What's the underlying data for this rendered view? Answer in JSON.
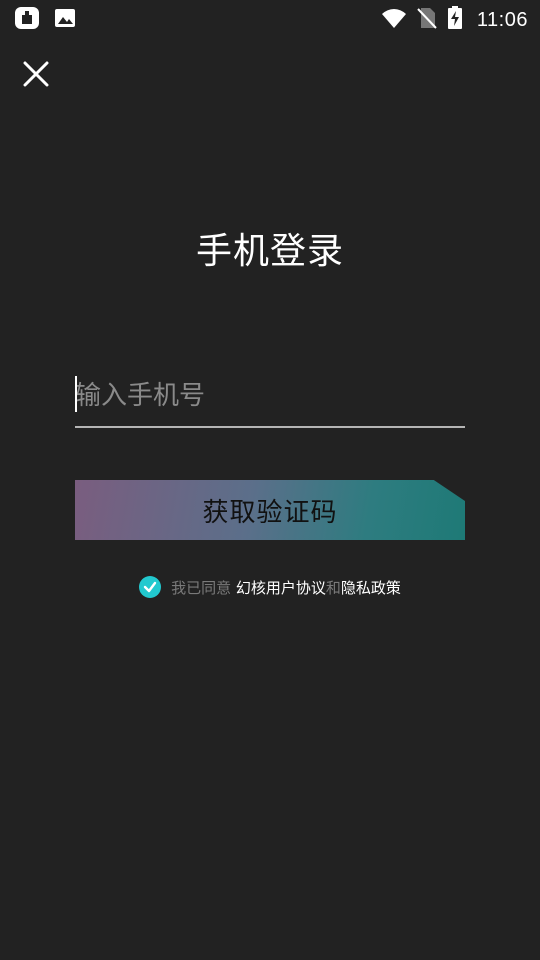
{
  "status_bar": {
    "time": "11:06",
    "icons": [
      "notification-app-icon",
      "image-icon",
      "wifi-icon",
      "no-sim-icon",
      "battery-charging-icon"
    ]
  },
  "header": {
    "close_icon": "close-icon"
  },
  "login": {
    "title": "手机登录",
    "phone_placeholder": "输入手机号",
    "phone_value": "",
    "get_code_label": "获取验证码"
  },
  "agreement": {
    "checked": true,
    "prefix": "我已同意",
    "user_agreement": "幻核用户协议",
    "and": "和",
    "privacy_policy": "隐私政策"
  },
  "colors": {
    "background": "#222222",
    "accent": "#22c9cf",
    "gradient_start": "#7a5d7f",
    "gradient_end": "#1e7a76"
  }
}
